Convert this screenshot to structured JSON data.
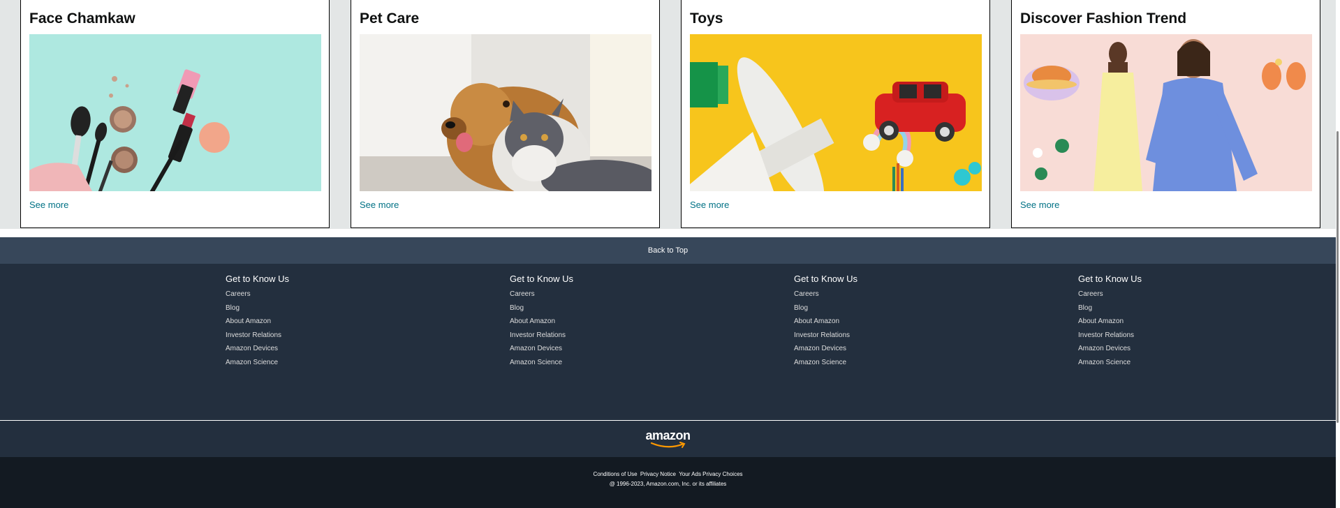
{
  "cards": [
    {
      "title": "Face Chamkaw",
      "image": "makeup-products-image",
      "link": "See more"
    },
    {
      "title": "Pet Care",
      "image": "dog-and-cat-image",
      "link": "See more"
    },
    {
      "title": "Toys",
      "image": "toys-image",
      "link": "See more"
    },
    {
      "title": "Discover Fashion Trend",
      "image": "fashion-models-image",
      "link": "See more"
    }
  ],
  "back_to_top": "Back to Top",
  "footer": {
    "columns": [
      {
        "title": "Get to Know Us",
        "links": [
          "Careers",
          "Blog",
          "About Amazon",
          "Investor Relations",
          "Amazon Devices",
          "Amazon Science"
        ]
      },
      {
        "title": "Get to Know Us",
        "links": [
          "Careers",
          "Blog",
          "About Amazon",
          "Investor Relations",
          "Amazon Devices",
          "Amazon Science"
        ]
      },
      {
        "title": "Get to Know Us",
        "links": [
          "Careers",
          "Blog",
          "About Amazon",
          "Investor Relations",
          "Amazon Devices",
          "Amazon Science"
        ]
      },
      {
        "title": "Get to Know Us",
        "links": [
          "Careers",
          "Blog",
          "About Amazon",
          "Investor Relations",
          "Amazon Devices",
          "Amazon Science"
        ]
      }
    ],
    "logo_text": "amazon",
    "legal_links": [
      "Conditions of Use",
      "Privacy Notice",
      "Your Ads Privacy Choices"
    ],
    "copyright": "@ 1996-2023, Amazon.com, Inc. or its affiliates"
  },
  "colors": {
    "link": "#007185",
    "back_to_top_bg": "#37475a",
    "footer_bg": "#232f3e",
    "bottom_bg": "#131a22",
    "logo_smile": "#ff9900"
  }
}
